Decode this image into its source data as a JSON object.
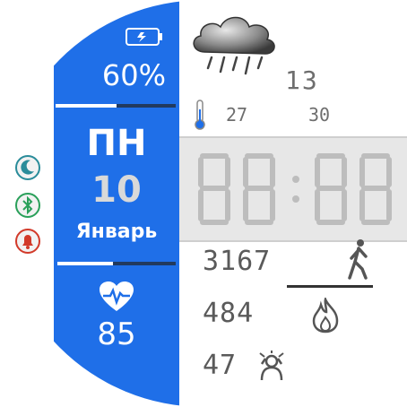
{
  "battery": {
    "percent_text": "60%",
    "level": 0.6
  },
  "date": {
    "weekday": "ПН",
    "day": "10",
    "month": "Январь"
  },
  "heart": {
    "rate": "85"
  },
  "weather": {
    "temp_now": "13",
    "temp_min": "27",
    "temp_max": "30"
  },
  "activity": {
    "steps": "3167",
    "calories": "484",
    "stress": "47"
  },
  "status_icons": [
    "moon-icon",
    "bluetooth-icon",
    "alarm-bell-icon"
  ],
  "colors": {
    "accent_blue": "#1f6fe8",
    "text_gray": "#5a5a5a"
  }
}
